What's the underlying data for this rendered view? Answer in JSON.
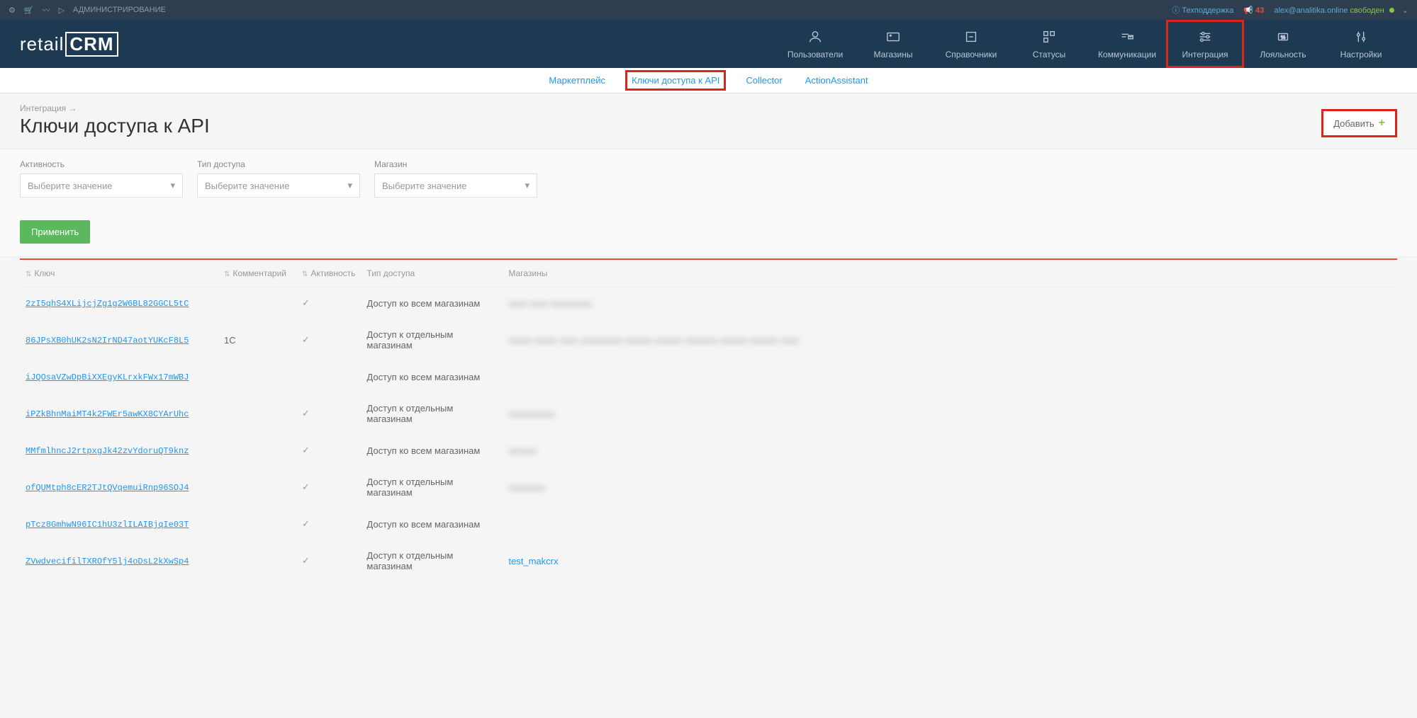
{
  "topbar": {
    "admin_label": "АДМИНИСТРИРОВАНИЕ",
    "support": "Техподдержка",
    "notif_count": "43",
    "user_email": "alex@analitika.online",
    "user_status": "свободен"
  },
  "nav": {
    "items": [
      {
        "label": "Пользователи"
      },
      {
        "label": "Магазины"
      },
      {
        "label": "Справочники"
      },
      {
        "label": "Статусы"
      },
      {
        "label": "Коммуникации"
      },
      {
        "label": "Интеграция"
      },
      {
        "label": "Лояльность"
      },
      {
        "label": "Настройки"
      }
    ]
  },
  "subnav": {
    "items": [
      {
        "label": "Маркетплейс"
      },
      {
        "label": "Ключи доступа к API"
      },
      {
        "label": "Collector"
      },
      {
        "label": "ActionAssistant"
      }
    ]
  },
  "page": {
    "breadcrumb": "Интеграция →",
    "title": "Ключи доступа к API",
    "add_button": "Добавить"
  },
  "filters": {
    "activity_label": "Активность",
    "access_type_label": "Тип доступа",
    "store_label": "Магазин",
    "placeholder": "Выберите значение",
    "apply": "Применить"
  },
  "table": {
    "headers": {
      "key": "Ключ",
      "comment": "Комментарий",
      "activity": "Активность",
      "access_type": "Тип доступа",
      "stores": "Магазины"
    },
    "rows": [
      {
        "key": "2zI5qhS4XLijcjZg1g2W6BL82GGCL5tC",
        "comment": "",
        "active": true,
        "access": "Доступ ко всем магазинам",
        "stores_blurred": true,
        "stores": "xxxx xxxx xxxxxxxxx"
      },
      {
        "key": "86JPsXB0hUK2sN2IrND47aotYUKcF8L5",
        "comment": "1C",
        "active": true,
        "access": "Доступ к отдельным магазинам",
        "stores_blurred": true,
        "stores": "xxxxx xxxxx xxxx xxxxxxxxx xxxxxx xxxxxx xxxxxxx xxxxxx xxxxxx xxxx"
      },
      {
        "key": "iJQOsaVZwDpBiXXEgyKLrxkFWx17mWBJ",
        "comment": "",
        "active": false,
        "access": "Доступ ко всем магазинам",
        "stores_blurred": false,
        "stores": ""
      },
      {
        "key": "iPZkBhnMaiMT4k2FWEr5awKX8CYArUhc",
        "comment": "",
        "active": true,
        "access": "Доступ к отдельным магазинам",
        "stores_blurred": true,
        "stores": "xxxxxxxxxx"
      },
      {
        "key": "MMfmlhncJ2rtpxgJk42zvYdoruQT9knz",
        "comment": "",
        "active": true,
        "access": "Доступ ко всем магазинам",
        "stores_blurred": true,
        "stores": "xxxxxx"
      },
      {
        "key": "ofQUMtph8cER2TJtQVqemuiRnp96SOJ4",
        "comment": "",
        "active": true,
        "access": "Доступ к отдельным магазинам",
        "stores_blurred": true,
        "stores": "xxxxxxxx"
      },
      {
        "key": "pTcz8GmhwN96IC1hU3zlILAIBjqIe03T",
        "comment": "",
        "active": true,
        "access": "Доступ ко всем магазинам",
        "stores_blurred": false,
        "stores": ""
      },
      {
        "key": "ZVwdvecifilTXROfY5lj4oDsL2kXwSp4",
        "comment": "",
        "active": true,
        "access": "Доступ к отдельным магазинам",
        "stores_blurred": false,
        "stores": "test_makcrx",
        "store_link": true
      }
    ]
  }
}
